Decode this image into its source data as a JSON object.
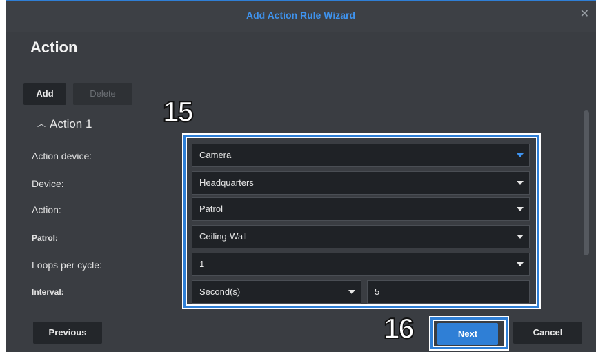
{
  "dialog": {
    "title": "Add Action Rule Wizard",
    "close_icon": "close-icon"
  },
  "page": {
    "heading": "Action"
  },
  "toolbar": {
    "add_label": "Add",
    "delete_label": "Delete"
  },
  "section": {
    "title": "Action 1",
    "collapse_icon": "chevron-up-icon"
  },
  "form": {
    "action_device": {
      "label": "Action device:",
      "value": "Camera"
    },
    "device": {
      "label": "Device:",
      "value": "Headquarters"
    },
    "action": {
      "label": "Action:",
      "value": "Patrol"
    },
    "patrol": {
      "label": "Patrol:",
      "value": "Ceiling-Wall"
    },
    "loops": {
      "label": "Loops per cycle:",
      "value": "1"
    },
    "interval": {
      "label": "Interval:",
      "unit": "Second(s)",
      "value": "5"
    }
  },
  "annotations": {
    "step1": "15",
    "step2": "16",
    "highlight_color": "#2f7fd6"
  },
  "footer": {
    "previous_label": "Previous",
    "next_label": "Next",
    "cancel_label": "Cancel"
  },
  "colors": {
    "accent": "#2f7fd6",
    "background": "#3a3d42",
    "field": "#1f2226"
  }
}
